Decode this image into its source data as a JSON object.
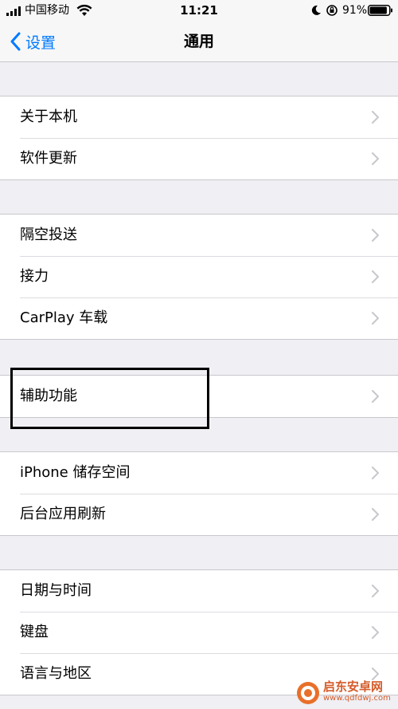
{
  "status_bar": {
    "carrier": "中国移动",
    "time": "11:21",
    "battery_percent": "91%",
    "battery_level": 0.91
  },
  "nav": {
    "back_label": "设置",
    "title": "通用"
  },
  "groups": [
    {
      "items": [
        {
          "label": "关于本机"
        },
        {
          "label": "软件更新"
        }
      ]
    },
    {
      "items": [
        {
          "label": "隔空投送"
        },
        {
          "label": "接力"
        },
        {
          "label": "CarPlay 车载"
        }
      ]
    },
    {
      "items": [
        {
          "label": "辅助功能"
        }
      ]
    },
    {
      "items": [
        {
          "label": "iPhone 储存空间"
        },
        {
          "label": "后台应用刷新"
        }
      ]
    },
    {
      "items": [
        {
          "label": "日期与时间"
        },
        {
          "label": "键盘"
        },
        {
          "label": "语言与地区"
        }
      ]
    }
  ],
  "watermark": {
    "name": "启东安卓网",
    "url": "www.qdfdwj.com"
  },
  "colors": {
    "accent": "#007aff",
    "background": "#efeff4",
    "chevron": "#c7c7cc",
    "highlight_box": "#000000"
  },
  "icons": {
    "back": "chevron-left-icon",
    "row_disclosure": "chevron-right-icon",
    "wifi": "wifi-icon",
    "moon": "moon-icon",
    "orientation_lock": "orientation-lock-icon",
    "battery": "battery-icon"
  }
}
